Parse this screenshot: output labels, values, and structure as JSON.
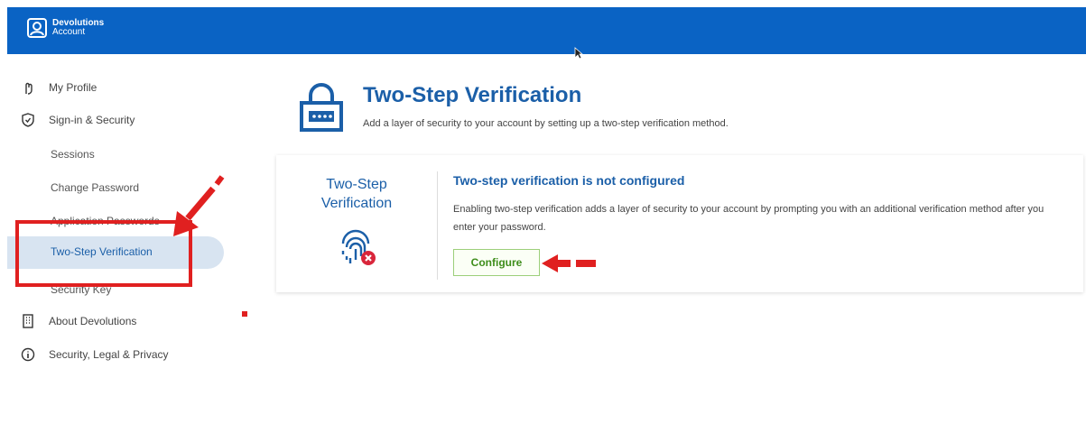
{
  "header": {
    "brand_name": "Devolutions",
    "brand_sub": "Account"
  },
  "sidebar": {
    "my_profile": "My Profile",
    "sign_in_security": "Sign-in & Security",
    "sessions": "Sessions",
    "change_password": "Change Password",
    "application_passwords": "Application Passwords",
    "two_step_verification": "Two-Step Verification",
    "security_key": "Security Key",
    "about_devolutions": "About Devolutions",
    "security_legal_privacy": "Security, Legal & Privacy"
  },
  "main": {
    "title": "Two-Step Verification",
    "description": "Add a layer of security to your account by setting up a two-step verification method.",
    "card": {
      "left_title_line1": "Two-Step",
      "left_title_line2": "Verification",
      "heading": "Two-step verification is not configured",
      "text": "Enabling two-step verification adds a layer of security to your account by prompting you with an additional verification method after you enter your password.",
      "configure_label": "Configure"
    }
  },
  "colors": {
    "header_bg": "#0a63c4",
    "accent": "#1b5fa8",
    "active_bg": "#d8e4f1",
    "annotation_red": "#e02020",
    "configure_green": "#3e8d1b"
  }
}
